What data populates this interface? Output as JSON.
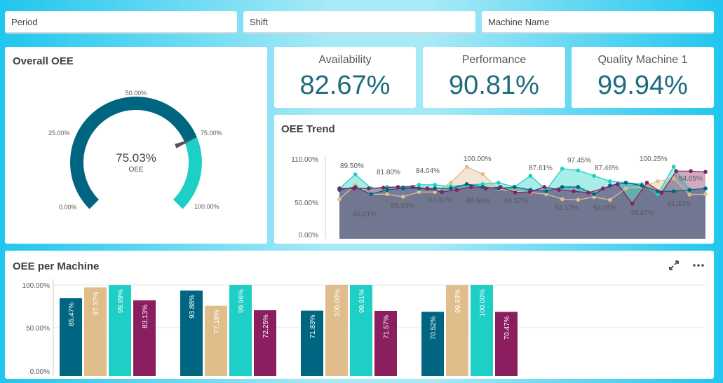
{
  "filters": {
    "period": "Period",
    "shift": "Shift",
    "machine_name": "Machine Name"
  },
  "overall_oee": {
    "title": "Overall OEE",
    "value_text": "75.03%",
    "value_label": "OEE",
    "value": 75.03,
    "scale_labels": [
      "0.00%",
      "25.00%",
      "50.00%",
      "75.00%",
      "100.00%"
    ],
    "colors": {
      "primary": "#006580",
      "secondary": "#1dcfc4",
      "needle": "#555555"
    }
  },
  "kpis": {
    "availability": {
      "label": "Availability",
      "value": "82.67%"
    },
    "performance": {
      "label": "Performance",
      "value": "90.81%"
    },
    "quality": {
      "label": "Quality Machine 1",
      "value": "99.94%"
    }
  },
  "oee_trend": {
    "title": "OEE Trend",
    "y_ticks": [
      "110.00%",
      "50.00%",
      "0.00%"
    ],
    "point_labels": [
      "89.50%",
      "46.21%",
      "81.80%",
      "58.33%",
      "84.04%",
      "64.87%",
      "100.00%",
      "68.98%",
      "64.37%",
      "87.61%",
      "54.17%",
      "97.45%",
      "87.46%",
      "54.05%",
      "48.87%",
      "100.25%",
      "61.33%",
      "94.05%"
    ]
  },
  "oee_per_machine": {
    "title": "OEE per Machine",
    "expand_icon": "expand-icon",
    "more_icon": "more-icon"
  },
  "chart_data": [
    {
      "type": "area",
      "title": "OEE Trend",
      "ylim": [
        0,
        110
      ],
      "y_ticks": [
        0,
        50,
        110
      ],
      "series": [
        {
          "color": "#1dcfc4",
          "values": [
            70,
            89.5,
            70,
            72,
            72,
            75,
            75,
            73,
            75,
            76,
            78,
            72,
            87.61,
            68,
            97.45,
            95,
            87.46,
            80,
            78,
            76,
            62,
            100.25,
            68,
            70
          ]
        },
        {
          "color": "#e0be8c",
          "values": [
            55,
            75,
            62,
            62,
            58.33,
            65,
            65,
            78,
            100,
            90,
            68.98,
            66,
            64.37,
            62,
            55,
            54.17,
            58,
            54.05,
            70,
            72,
            80,
            84,
            61.33,
            62
          ]
        },
        {
          "color": "#006580",
          "values": [
            68,
            72,
            62,
            68,
            70,
            70,
            70,
            70,
            76,
            72,
            70,
            72,
            68,
            66,
            72,
            72,
            62,
            74,
            78,
            74,
            66,
            66,
            68,
            70
          ]
        },
        {
          "color": "#8b1e5f",
          "values": [
            70,
            70,
            70,
            71,
            72,
            72,
            70,
            65,
            68,
            72,
            70,
            72,
            64.37,
            65,
            72,
            68,
            66,
            64,
            70,
            76,
            48.87,
            78,
            64,
            94.05,
            94.05,
            93
          ]
        }
      ]
    },
    {
      "type": "bar",
      "title": "OEE per Machine",
      "ylim": [
        0,
        100
      ],
      "y_ticks": [
        0,
        50,
        100
      ],
      "categories": [
        "",
        "",
        "",
        ""
      ],
      "series": [
        {
          "color": "#006580",
          "values": [
            85.47,
            93.88,
            71.83,
            70.52
          ],
          "labels": [
            "85.47%",
            "93.88%",
            "71.83%",
            "70.52%"
          ]
        },
        {
          "color": "#e0be8c",
          "values": [
            97.37,
            77.18,
            100.0,
            99.93
          ],
          "labels": [
            "97.37%",
            "77.18%",
            "100.00%",
            "99.93%"
          ]
        },
        {
          "color": "#1dcfc4",
          "values": [
            99.89,
            99.96,
            99.91,
            100.0
          ],
          "labels": [
            "99.89%",
            "99.96%",
            "99.91%",
            "100.00%"
          ]
        },
        {
          "color": "#8b1e5f",
          "values": [
            83.13,
            72.25,
            71.57,
            70.47
          ],
          "labels": [
            "83.13%",
            "72.25%",
            "71.57%",
            "70.47%"
          ]
        }
      ],
      "y_tick_labels": [
        "100.00%",
        "50.00%",
        "0.00%"
      ]
    }
  ]
}
